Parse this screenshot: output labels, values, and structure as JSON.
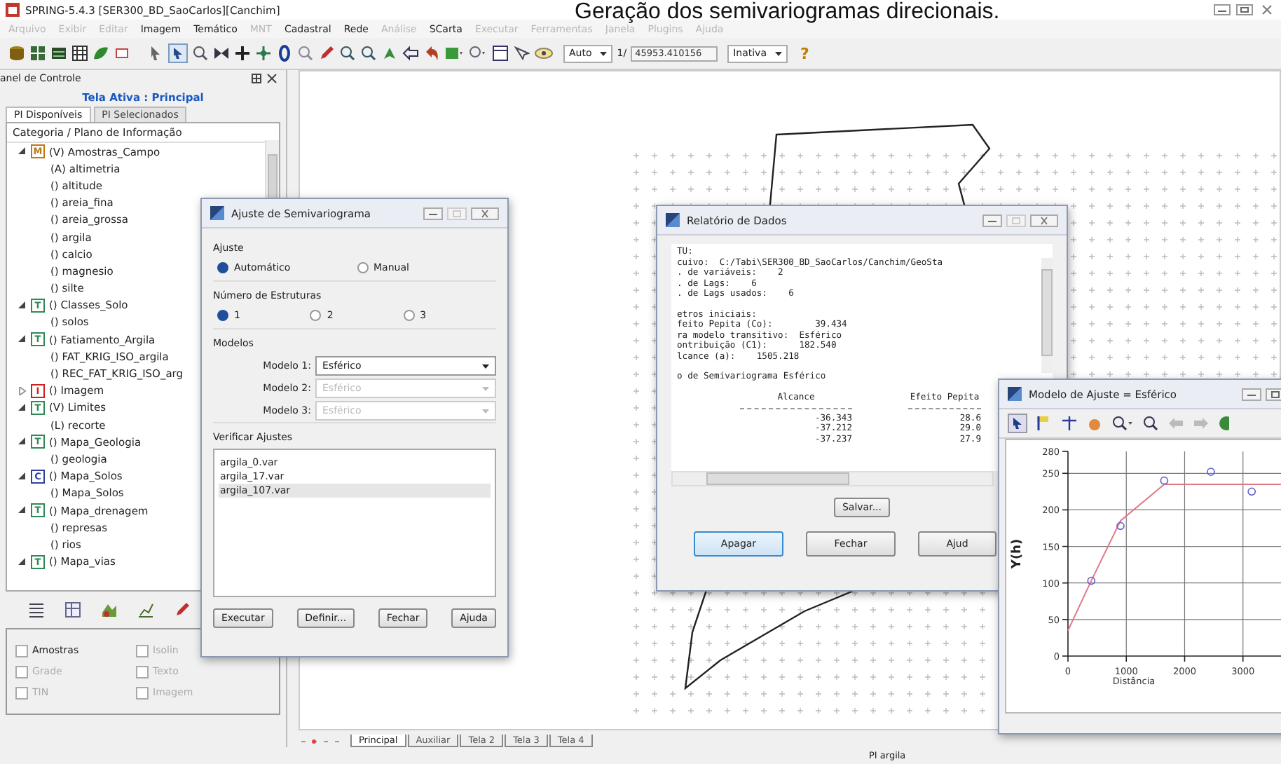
{
  "caption": "Geração dos semivariogramas direcionais.",
  "window": {
    "title": "SPRING-5.4.3 [SER300_BD_SaoCarlos][Canchim]"
  },
  "menu": [
    {
      "label": "Arquivo",
      "disabled": true
    },
    {
      "label": "Exibir",
      "disabled": true
    },
    {
      "label": "Editar",
      "disabled": true
    },
    {
      "label": "Imagem",
      "disabled": false
    },
    {
      "label": "Temático",
      "disabled": false
    },
    {
      "label": "MNT",
      "disabled": true
    },
    {
      "label": "Cadastral",
      "disabled": false
    },
    {
      "label": "Rede",
      "disabled": false
    },
    {
      "label": "Análise",
      "disabled": true
    },
    {
      "label": "SCarta",
      "disabled": false
    },
    {
      "label": "Executar",
      "disabled": true
    },
    {
      "label": "Ferramentas",
      "disabled": true
    },
    {
      "label": "Janela",
      "disabled": true
    },
    {
      "label": "Plugins",
      "disabled": true
    },
    {
      "label": "Ajuda",
      "disabled": true
    }
  ],
  "toolbar": {
    "zoom_mode": "Auto",
    "scale_prefix": "1/",
    "scale": "45953.410156",
    "cursor_mode": "Inativa",
    "help": "?"
  },
  "panel": {
    "title": "anel de Controle",
    "active_screen": "Tela Ativa : Principal",
    "tabs": [
      {
        "label": "PI Disponíveis",
        "selected": true
      },
      {
        "label": "PI Selecionados",
        "selected": false
      }
    ],
    "column": "Categoria / Plano de Informação",
    "tree": [
      {
        "badge": "M",
        "color": "#c07818",
        "label": "(V) Amostras_Campo",
        "expanded": true,
        "children": [
          {
            "label": "(A) altimetria"
          },
          {
            "label": "() altitude"
          },
          {
            "label": "() areia_fina"
          },
          {
            "label": "() areia_grossa"
          },
          {
            "label": "() argila"
          },
          {
            "label": "() calcio"
          },
          {
            "label": "() magnesio"
          },
          {
            "label": "() silte"
          }
        ]
      },
      {
        "badge": "T",
        "color": "#2e8b57",
        "label": "() Classes_Solo",
        "expanded": true,
        "children": [
          {
            "label": "() solos"
          }
        ]
      },
      {
        "badge": "T",
        "color": "#2e8b57",
        "label": "() Fatiamento_Argila",
        "expanded": true,
        "children": [
          {
            "label": "() FAT_KRIG_ISO_argila"
          },
          {
            "label": "() REC_FAT_KRIG_ISO_arg"
          }
        ]
      },
      {
        "badge": "I",
        "color": "#d02020",
        "label": "() Imagem",
        "expanded": false
      },
      {
        "badge": "T",
        "color": "#2e8b57",
        "label": "(V) Limites",
        "expanded": true,
        "children": [
          {
            "label": "(L) recorte"
          }
        ]
      },
      {
        "badge": "T",
        "color": "#2e8b57",
        "label": "() Mapa_Geologia",
        "expanded": true,
        "children": [
          {
            "label": "() geologia"
          }
        ]
      },
      {
        "badge": "C",
        "color": "#3040a0",
        "label": "() Mapa_Solos",
        "expanded": true,
        "children": [
          {
            "label": "() Mapa_Solos"
          }
        ]
      },
      {
        "badge": "T",
        "color": "#2e8b57",
        "label": "() Mapa_drenagem",
        "expanded": true,
        "children": [
          {
            "label": "() represas"
          },
          {
            "label": "() rios"
          }
        ]
      },
      {
        "badge": "T",
        "color": "#2e8b57",
        "label": "() Mapa_vias",
        "expanded": true
      }
    ],
    "checks": [
      {
        "label": "Amostras",
        "disabled": false
      },
      {
        "label": "Isolin",
        "disabled": true
      },
      {
        "label": "Grade",
        "disabled": true
      },
      {
        "label": "Texto",
        "disabled": true
      },
      {
        "label": "TIN",
        "disabled": true
      },
      {
        "label": "Imagem",
        "disabled": true
      }
    ]
  },
  "semivariogram_dialog": {
    "title": "Ajuste de Semivariograma",
    "fit_label": "Ajuste",
    "fit_options": [
      {
        "label": "Automático",
        "selected": true
      },
      {
        "label": "Manual",
        "selected": false
      }
    ],
    "structures_label": "Número de Estruturas",
    "structures": [
      {
        "label": "1",
        "selected": true
      },
      {
        "label": "2",
        "selected": false
      },
      {
        "label": "3",
        "selected": false
      }
    ],
    "models_label": "Modelos",
    "models": [
      {
        "label": "Modelo 1:",
        "value": "Esférico",
        "disabled": false
      },
      {
        "label": "Modelo 2:",
        "value": "Esférico",
        "disabled": true
      },
      {
        "label": "Modelo 3:",
        "value": "Esférico",
        "disabled": true
      }
    ],
    "verify_label": "Verificar Ajustes",
    "files": [
      {
        "label": "argila_0.var",
        "selected": false
      },
      {
        "label": "argila_17.var",
        "selected": false
      },
      {
        "label": "argila_107.var",
        "selected": true
      }
    ],
    "buttons": [
      "Executar",
      "Definir...",
      "Fechar",
      "Ajuda"
    ]
  },
  "report_dialog": {
    "title": "Relatório de Dados",
    "blocks": [
      [
        "TU:",
        "cuivo:  C:/Tabi\\SER300_BD_SaoCarlos/Canchim/GeoSta",
        ". de variáveis:    2",
        ". de Lags:    6",
        ". de Lags usados:    6"
      ],
      [
        "etros iniciais:",
        "feito Pepita (Co):        39.434",
        "ra modelo transitivo:  Esférico",
        "ontribuição (C1):      182.540",
        "lcance (a):    1505.218"
      ],
      [
        "o de Semivariograma Esférico"
      ]
    ],
    "table": {
      "columns": [
        "Alcance",
        "Efeito Pepita"
      ],
      "rows": [
        [
          "-36.343",
          "28.6"
        ],
        [
          "-37.212",
          "29.0"
        ],
        [
          "-37.237",
          "27.9"
        ]
      ]
    },
    "save": "Salvar...",
    "buttons": [
      {
        "label": "Apagar",
        "focused": true
      },
      {
        "label": "Fechar",
        "focused": false
      },
      {
        "label": "Ajud",
        "focused": false
      }
    ]
  },
  "model_window": {
    "title": "Modelo de Ajuste = Esférico",
    "chart_data": {
      "type": "line",
      "xlabel": "Distância",
      "ylabel": "Y(h)",
      "x": [
        0,
        400,
        900,
        1650,
        2450,
        3150,
        3700
      ],
      "series": [
        {
          "type": "line",
          "color": "#e07888",
          "values": [
            35,
            103,
            185,
            235,
            235,
            235,
            235
          ]
        },
        {
          "type": "scatter",
          "color": "#6a6ad0",
          "values": [
            null,
            103,
            178,
            240,
            252,
            225,
            null
          ]
        }
      ],
      "xlim": [
        0,
        3700
      ],
      "ylim": [
        0,
        280
      ],
      "xticks": [
        0,
        1000,
        2000,
        3000
      ],
      "yticks": [
        0,
        50,
        100,
        150,
        200,
        250,
        280
      ],
      "grid": true
    }
  },
  "canvas_tabs": [
    {
      "label": "Principal",
      "selected": true
    },
    {
      "label": "Auxiliar",
      "selected": false
    },
    {
      "label": "Tela 2",
      "selected": false
    },
    {
      "label": "Tela 3",
      "selected": false
    },
    {
      "label": "Tela 4",
      "selected": false
    }
  ],
  "status_bar": {
    "layer": "PI argila"
  }
}
